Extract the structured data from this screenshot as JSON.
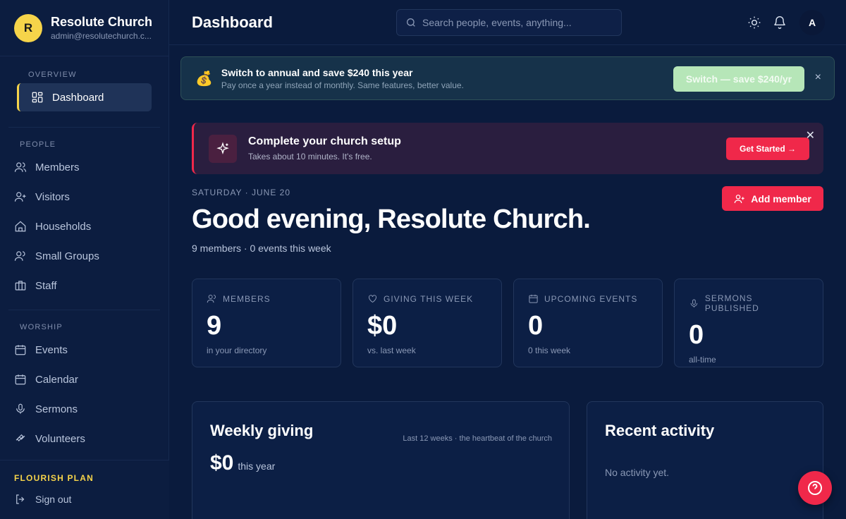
{
  "brand": {
    "initial": "R",
    "name": "Resolute Church",
    "email": "admin@resolutechurch.c..."
  },
  "nav": {
    "overview_heading": "OVERVIEW",
    "dashboard": "Dashboard",
    "people_heading": "PEOPLE",
    "members": "Members",
    "visitors": "Visitors",
    "households": "Households",
    "small_groups": "Small Groups",
    "staff": "Staff",
    "worship_heading": "WORSHIP",
    "events": "Events",
    "calendar": "Calendar",
    "sermons": "Sermons",
    "volunteers": "Volunteers"
  },
  "footer": {
    "plan": "FLOURISH PLAN",
    "sign_out": "Sign out"
  },
  "header": {
    "title": "Dashboard",
    "search_placeholder": "Search people, events, anything...",
    "user_initial": "A"
  },
  "annual_banner": {
    "icon": "money-bag-icon",
    "title": "Switch to annual and save $240 this year",
    "subtitle": "Pay once a year instead of monthly. Same features, better value.",
    "button": "Switch — save $240/yr",
    "close": "×"
  },
  "setup_banner": {
    "title": "Complete your church setup",
    "subtitle": "Takes about 10 minutes. It's free.",
    "button": "Get Started →",
    "close": "✕"
  },
  "greeting": {
    "date": "SATURDAY · JUNE 20",
    "headline": "Good evening, Resolute Church.",
    "summary": "9 members · 0 events this week",
    "add_member": "Add member"
  },
  "stats": [
    {
      "label": "MEMBERS",
      "value": "9",
      "sub": "in your directory"
    },
    {
      "label": "GIVING THIS WEEK",
      "value": "$0",
      "sub": "vs. last week"
    },
    {
      "label": "UPCOMING EVENTS",
      "value": "0",
      "sub": "0 this week"
    },
    {
      "label": "SERMONS PUBLISHED",
      "value": "0",
      "sub": "all-time"
    }
  ],
  "giving_panel": {
    "title": "Weekly giving",
    "note": "Last 12 weeks · the heartbeat of the church",
    "amount": "$0",
    "amount_suffix": "this year"
  },
  "activity_panel": {
    "title": "Recent activity",
    "empty": "No activity yet."
  },
  "colors": {
    "accent": "#f0284a",
    "brand_yellow": "#f6d44a",
    "background": "#0a1b3d",
    "annual_button": "#b6e6b8"
  }
}
